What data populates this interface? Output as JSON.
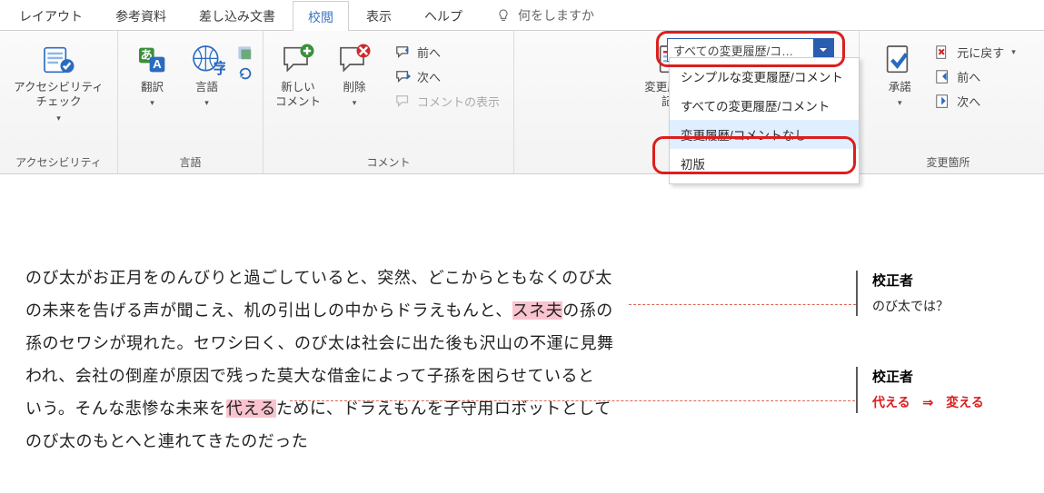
{
  "tabs": {
    "layout": "レイアウト",
    "references": "参考資料",
    "mailings": "差し込み文書",
    "review": "校閲",
    "view": "表示",
    "help": "ヘルプ",
    "tellme_placeholder": "何をしますか"
  },
  "ribbon": {
    "accessibility": {
      "label": "アクセシビリティ\nチェック",
      "group": "アクセシビリティ"
    },
    "translate": "翻訳",
    "language": "言語",
    "lang_group": "言語",
    "new_comment": "新しい\nコメント",
    "delete": "削除",
    "prev": "前へ",
    "next": "次へ",
    "show_comments": "コメントの表示",
    "comment_group": "コメント",
    "track_changes": "変更履歴の\n記録",
    "accept": "承諾",
    "undo": "元に戻す",
    "prev_change": "前へ",
    "next_change": "次へ",
    "changes_group": "変更箇所"
  },
  "combo": {
    "selected": "すべての変更履歴/コ…",
    "options": [
      "シンプルな変更履歴/コメント",
      "すべての変更履歴/コメント",
      "変更履歴/コメントなし",
      "初版"
    ]
  },
  "doc": {
    "line1": "のび太がお正月をのんびりと過ごしていると、突然、どこからともなくのび太",
    "line2_a": "の未来を告げる声が聞こえ、机の引出しの中からドラえもんと、",
    "line2_hl": "スネ夫",
    "line2_b": "の孫の",
    "line3": "孫のセワシが現れた。セワシ曰く、のび太は社会に出た後も沢山の不運に見舞",
    "line4": "われ、会社の倒産が原因で残った莫大な借金によって子孫を困らせていると",
    "line5_a": "いう。そんな悲惨な未来を",
    "line5_hl": "代える",
    "line5_b": "ために、ドラえもんを子守用ロボットとして",
    "line6": "のび太のもとへと連れてきたのだった"
  },
  "comments": {
    "c1_author": "校正者",
    "c1_body": "のび太では？",
    "c2_author": "校正者",
    "c2_from": "代える",
    "c2_arrow": "⇒",
    "c2_to": "変える"
  }
}
